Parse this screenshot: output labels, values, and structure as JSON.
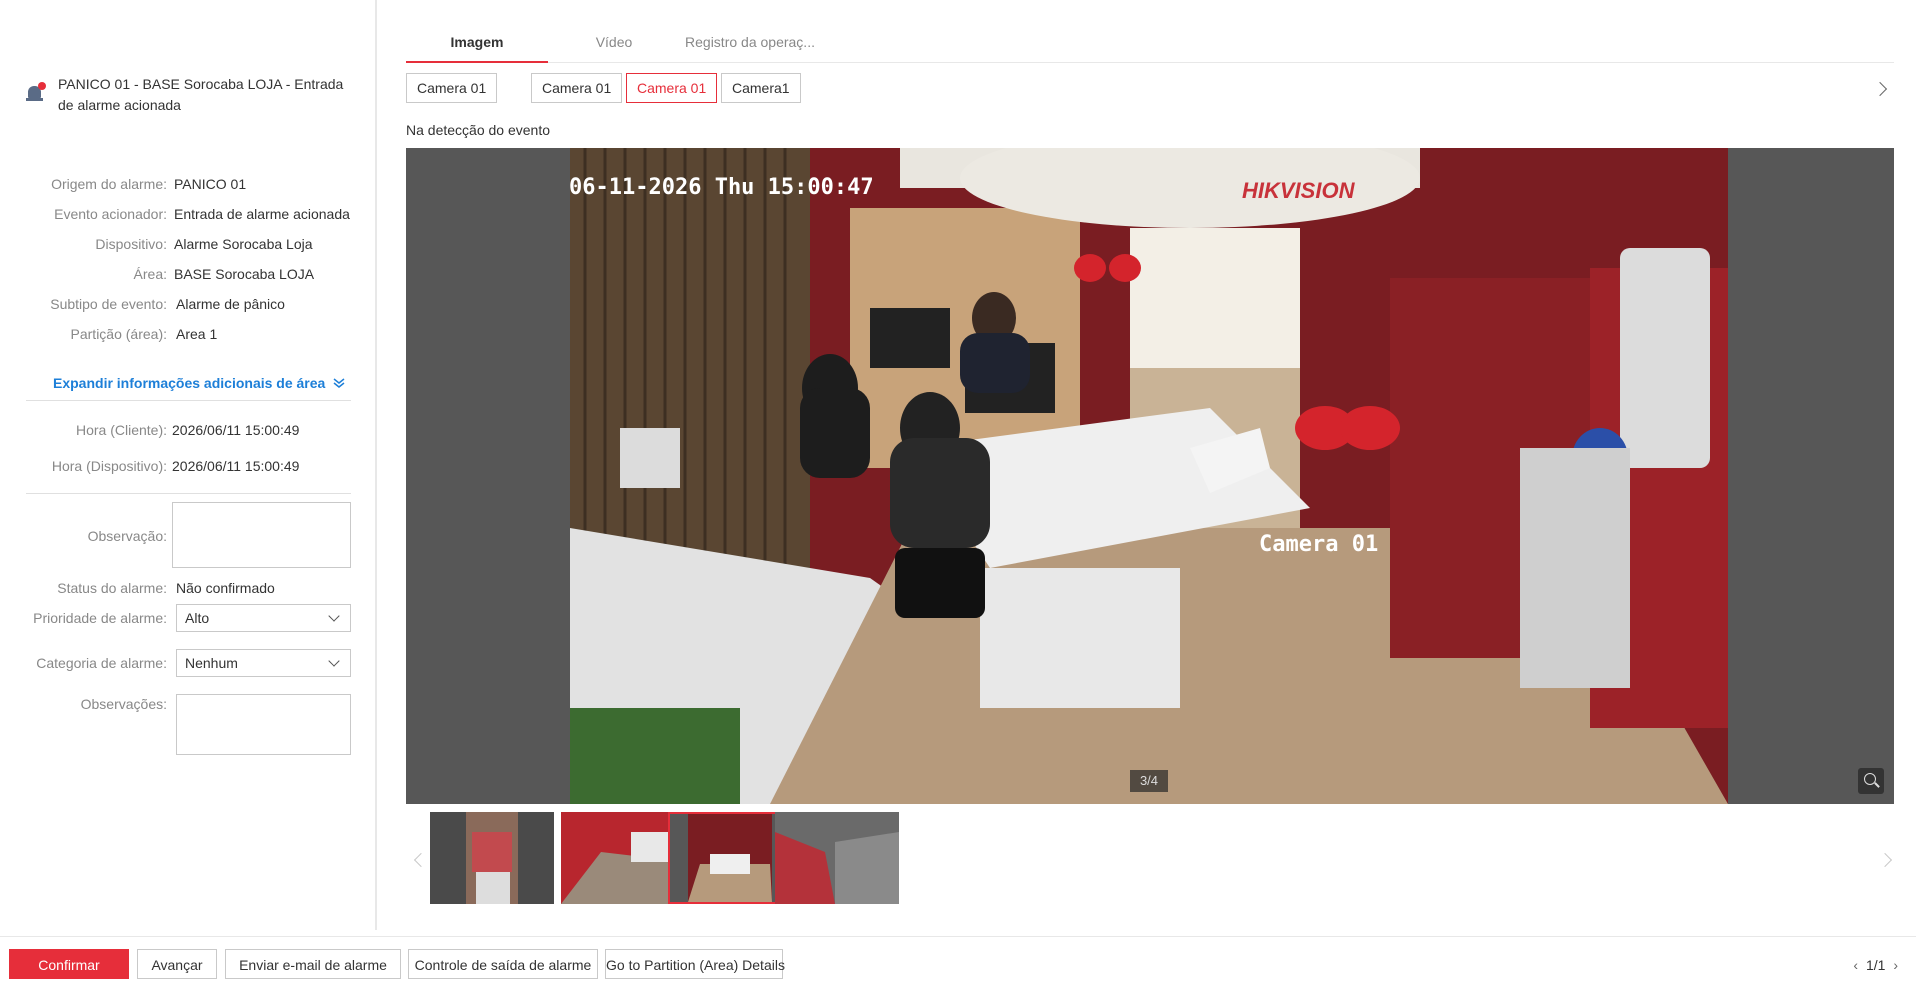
{
  "alarm": {
    "title": "PANICO 01 - BASE Sorocaba LOJA - Entrada de alarme acionada"
  },
  "details": [
    {
      "label": "Origem do alarme:",
      "value": "PANICO 01"
    },
    {
      "label": "Evento acionador:",
      "value": "Entrada de alarme acionada"
    },
    {
      "label": "Dispositivo:",
      "value": "Alarme Sorocaba Loja"
    },
    {
      "label": "Área:",
      "value": "BASE Sorocaba LOJA"
    },
    {
      "label": "Subtipo de evento:",
      "value": "Alarme de pânico"
    },
    {
      "label": "Partição (área):",
      "value": "Area 1"
    }
  ],
  "expand_label": "Expandir informações adicionais de área",
  "times": [
    {
      "label": "Hora (Cliente):",
      "value": "2026/06/11 15:00:49"
    },
    {
      "label": "Hora (Dispositivo):",
      "value": "2026/06/11 15:00:49"
    }
  ],
  "form": {
    "observacao_label": "Observação:",
    "observacao_value": "",
    "status_label": "Status do alarme:",
    "status_value": "Não confirmado",
    "priority_label": "Prioridade de alarme:",
    "priority_value": "Alto",
    "category_label": "Categoria de alarme:",
    "category_value": "Nenhum",
    "observacoes_label": "Observações:",
    "observacoes_value": ""
  },
  "tabs": [
    "Imagem",
    "Vídeo",
    "Registro da operaç..."
  ],
  "cameras": [
    "Camera 01",
    "Camera 01",
    "Camera 01",
    "Camera1"
  ],
  "detect_label": "Na detecção do evento",
  "overlay": {
    "timestamp": "06-11-2026 Thu 15:00:47",
    "brand": "HIKVISION",
    "camera_name": "Camera 01"
  },
  "counter": "3/4",
  "buttons": {
    "confirm": "Confirmar",
    "advance": "Avançar",
    "email": "Enviar e-mail de alarme",
    "output": "Controle de saída de alarme",
    "partition": "Go to Partition (Area) Details"
  },
  "pager": "1/1",
  "colors": {
    "accent": "#e62e3a",
    "link": "#1d7fd8"
  }
}
